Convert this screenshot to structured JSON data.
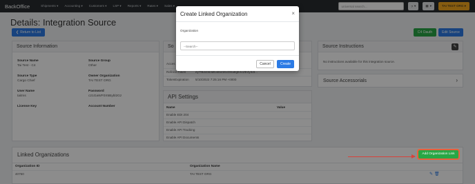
{
  "nav": {
    "brand": "BackOffice",
    "menu": [
      "Shipments ▾",
      "Accounting ▾",
      "Customers ▾",
      "LSP ▾",
      "Reports ▾",
      "Rates ▾",
      "Sales ▾"
    ],
    "search_placeholder": "universal search...",
    "help": "?",
    "grid": "▦",
    "org": "TAI TEST ORG ▾"
  },
  "page": {
    "title": "Details: Integration Source",
    "back_label": "Return to List",
    "c4_label": "C4 Oauth",
    "edit_label": "Edit Source"
  },
  "source_info": {
    "header": "Source Information",
    "fields": [
      {
        "label": "Source Name",
        "value": "Tai Test - C4"
      },
      {
        "label": "Source Group",
        "value": "Other"
      },
      {
        "label": "Source Type",
        "value": "Cargo Chief"
      },
      {
        "label": "Owner Organization",
        "value": "TAI TEST ORG"
      },
      {
        "label": "User Name",
        "value": "taitms"
      },
      {
        "label": "Password",
        "value": "c21GaWF0X5Bybl2Gz"
      },
      {
        "label": "License Key",
        "value": ""
      },
      {
        "label": "Account Number",
        "value": ""
      }
    ]
  },
  "middle": {
    "header_fragment": "So",
    "rows": [
      {
        "name": "Acces",
        "value": "d*"
      },
      {
        "name": "RefreshToken",
        "value": "ey7f8dcb53dEa5b4b5cDEa8gE4cZE4y3dt..."
      },
      {
        "name": "TokenExpiration",
        "value": "5/10/2022 7:25:16 PM +0000"
      }
    ]
  },
  "api_settings": {
    "header": "API Settings",
    "col_name": "Name",
    "col_value": "Value",
    "rows": [
      "Enable EDI 204",
      "Enable API Dispatch",
      "Enable API Tracking",
      "Enable API Documents"
    ]
  },
  "instructions": {
    "header": "Source Instructions",
    "text": "No instructions available for this integration source."
  },
  "accessorials": {
    "header": "Source Accessorials"
  },
  "linked": {
    "header": "Linked Organizations",
    "add_label": "Add Organization Link",
    "col_id": "Organization ID",
    "col_name": "Organization Name",
    "rows": [
      {
        "id": "40750",
        "name": "TAI TEST ORG"
      }
    ]
  },
  "modal": {
    "title": "Create Linked Organization",
    "close": "×",
    "label": "Organization",
    "placeholder": "--Search--",
    "cancel": "Cancel",
    "create": "Create"
  },
  "colors": {
    "primary": "#2c7be5",
    "success": "#28a745",
    "accent": "#f5a81e",
    "annotation": "#d9413a"
  }
}
